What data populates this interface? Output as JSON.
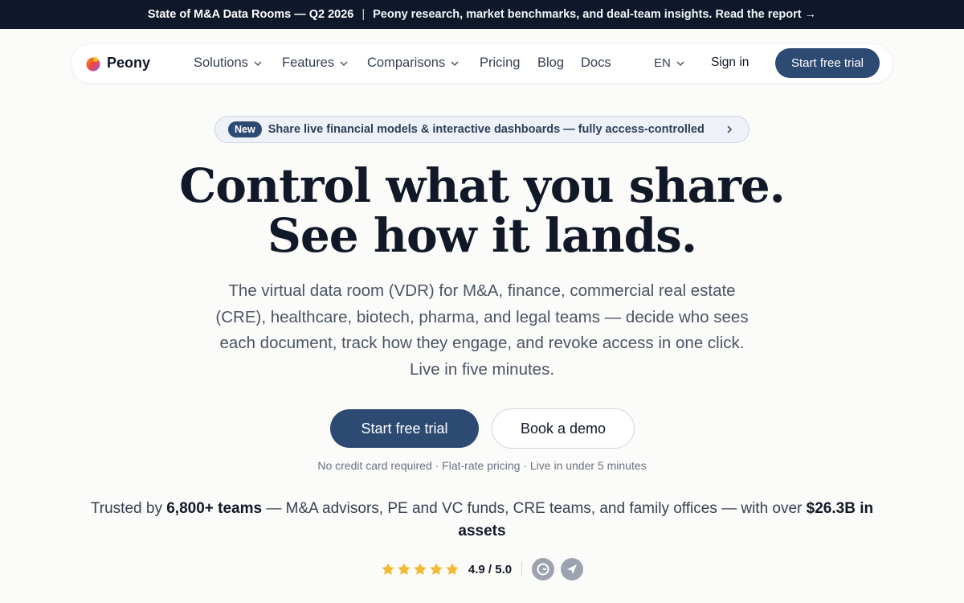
{
  "banner": {
    "title": "State of M&A Data Rooms — Q2 2026",
    "separator": "|",
    "desc": "Peony research, market benchmarks, and deal-team insights. Read the report →"
  },
  "nav": {
    "brand": "Peony",
    "links": [
      "Solutions",
      "Features",
      "Comparisons",
      "Pricing",
      "Blog",
      "Docs"
    ],
    "language": "EN",
    "signin": "Sign in",
    "cta": "Start free trial"
  },
  "announcement": {
    "badge": "New",
    "text": "Share live financial models & interactive dashboards — fully access-controlled"
  },
  "hero": {
    "headline_line1": "Control what you share.",
    "headline_line2": "See how it lands.",
    "subhead": "The virtual data room (VDR) for M&A, finance, commercial real estate (CRE), healthcare, biotech, pharma, and legal teams — decide who sees each document, track how they engage, and revoke access in one click. Live in five minutes.",
    "primary_cta": "Start free trial",
    "secondary_cta": "Book a demo",
    "fineprint": "No credit card required · Flat-rate pricing · Live in under 5 minutes"
  },
  "trust": {
    "prefix": "Trusted by ",
    "teams": "6,800+ teams",
    "middle": " — M&A advisors, PE and VC funds, CRE teams, and family offices — with over ",
    "assets": "$26.3B in assets"
  },
  "rating": {
    "score": "4.9 / 5.0",
    "stars": 5,
    "icons": [
      "g2-icon",
      "capterra-icon"
    ]
  },
  "colors": {
    "brand": "#2c4a72",
    "banner_bg": "#0f172a",
    "star": "#f5b82e"
  }
}
